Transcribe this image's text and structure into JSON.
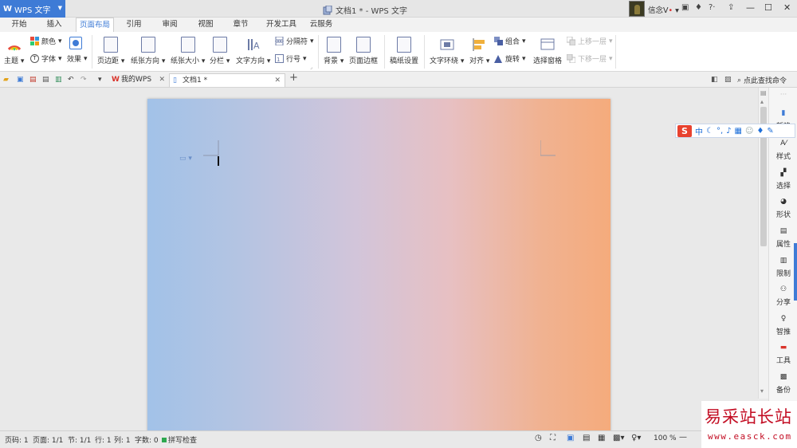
{
  "app": {
    "name": "WPS 文字",
    "window_title": "文档1 * - WPS 文字",
    "user": "信念V"
  },
  "menu_tabs": [
    "开始",
    "插入",
    "页面布局",
    "引用",
    "审阅",
    "视图",
    "章节",
    "开发工具",
    "云服务"
  ],
  "active_tab": "页面布局",
  "ribbon": {
    "theme": "主题",
    "colors": "颜色",
    "font": "字体",
    "effects": "效果",
    "margins": "页边距",
    "orientation": "纸张方向",
    "size": "纸张大小",
    "columns": "分栏",
    "text_direction": "文字方向",
    "breaks": "分隔符",
    "line_numbers": "行号",
    "background": "背景",
    "page_border": "页面边框",
    "draft_paper": "稿纸设置",
    "wrap_text": "文字环绕",
    "align": "对齐",
    "group": "组合",
    "rotate": "旋转",
    "selection_pane": "选择窗格",
    "bring_forward": "上移一层",
    "send_backward": "下移一层"
  },
  "doc_tabs": [
    {
      "label": "我的WPS"
    },
    {
      "label": "文档1 *"
    }
  ],
  "search_command": "点此查找命令",
  "right_pane": [
    "新建",
    "样式",
    "选择",
    "形状",
    "属性",
    "限制",
    "分享",
    "智推",
    "工具",
    "备份"
  ],
  "ime": {
    "logo": "S",
    "mode": "中"
  },
  "status": {
    "page_num": "页码: 1",
    "pages": "页面: 1/1",
    "section": "节: 1/1",
    "row": "行: 1",
    "col": "列: 1",
    "words": "字数: 0",
    "spell": "拼写检查",
    "zoom": "100 %"
  },
  "watermark": {
    "text": "易采站长站",
    "url": "www.easck.com"
  },
  "colors": {
    "accent": "#3e7bd6",
    "page_left": "#a2c2e8",
    "page_right": "#f5ab7c"
  }
}
